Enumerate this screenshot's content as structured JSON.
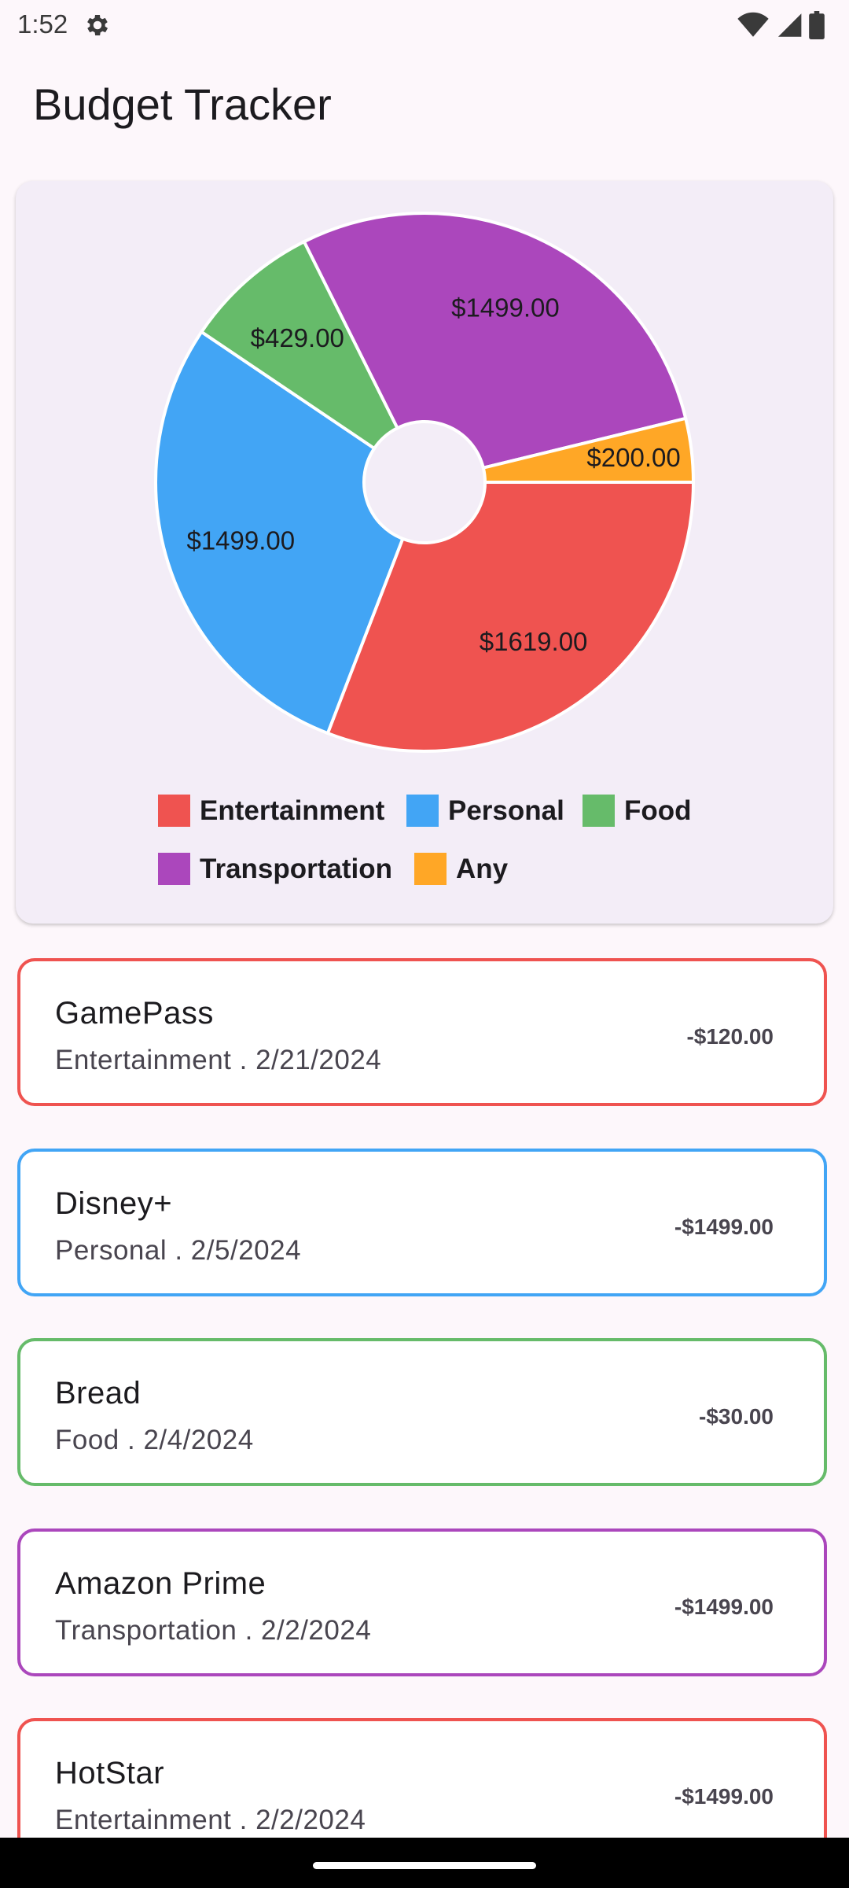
{
  "status": {
    "time": "1:52"
  },
  "app": {
    "title": "Budget Tracker"
  },
  "chart_data": {
    "type": "pie",
    "slices": [
      {
        "label": "Entertainment",
        "value": 1619.0,
        "value_label": "$1619.00",
        "color": "#ef5350"
      },
      {
        "label": "Personal",
        "value": 1499.0,
        "value_label": "$1499.00",
        "color": "#42a5f5"
      },
      {
        "label": "Food",
        "value": 429.0,
        "value_label": "$429.00",
        "color": "#66bb6a"
      },
      {
        "label": "Transportation",
        "value": 1499.0,
        "value_label": "$1499.00",
        "color": "#ab47bc"
      },
      {
        "label": "Any",
        "value": 200.0,
        "value_label": "$200.00",
        "color": "#ffa726"
      }
    ],
    "legend": [
      "Entertainment",
      "Personal",
      "Food",
      "Transportation",
      "Any"
    ]
  },
  "transactions": [
    {
      "name": "GamePass",
      "subtitle": "Entertainment . 2/21/2024",
      "amount": "-$120.00",
      "color": "#ef5350"
    },
    {
      "name": "Disney+",
      "subtitle": "Personal . 2/5/2024",
      "amount": "-$1499.00",
      "color": "#42a5f5"
    },
    {
      "name": "Bread",
      "subtitle": "Food . 2/4/2024",
      "amount": "-$30.00",
      "color": "#66bb6a"
    },
    {
      "name": "Amazon Prime",
      "subtitle": "Transportation . 2/2/2024",
      "amount": "-$1499.00",
      "color": "#ab47bc"
    },
    {
      "name": "HotStar",
      "subtitle": "Entertainment . 2/2/2024",
      "amount": "-$1499.00",
      "color": "#ef5350"
    }
  ]
}
